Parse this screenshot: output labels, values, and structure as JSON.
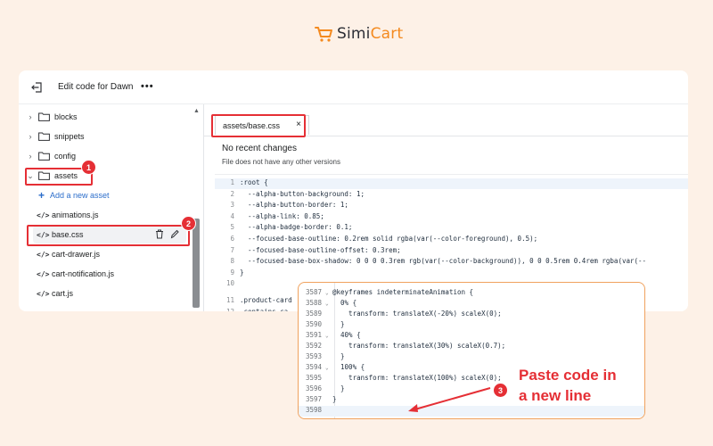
{
  "logo": {
    "text_main": "Simi",
    "text_accent": "Cart",
    "brand_color": "#f48a1f"
  },
  "topbar": {
    "title": "Edit code for Dawn",
    "more_label": "•••"
  },
  "sidebar": {
    "items": [
      {
        "type": "folder",
        "label": "blocks"
      },
      {
        "type": "folder",
        "label": "snippets"
      },
      {
        "type": "folder",
        "label": "config"
      },
      {
        "type": "folder-open",
        "label": "assets"
      },
      {
        "type": "add",
        "label": "Add a new asset"
      },
      {
        "type": "file",
        "label": "animations.js"
      },
      {
        "type": "file",
        "label": "base.css"
      },
      {
        "type": "file",
        "label": "cart-drawer.js"
      },
      {
        "type": "file",
        "label": "cart-notification.js"
      },
      {
        "type": "file",
        "label": "cart.js"
      }
    ]
  },
  "editor": {
    "tab_prefix": "assets/",
    "tab_file": "base.css",
    "tab_close": "×",
    "no_changes_title": "No recent changes",
    "no_changes_sub": "File does not have any other versions",
    "code": [
      {
        "n": "1",
        "t": ":root {"
      },
      {
        "n": "2",
        "t": "  --alpha-button-background: 1;"
      },
      {
        "n": "3",
        "t": "  --alpha-button-border: 1;"
      },
      {
        "n": "4",
        "t": "  --alpha-link: 0.85;"
      },
      {
        "n": "5",
        "t": "  --alpha-badge-border: 0.1;"
      },
      {
        "n": "6",
        "t": "  --focused-base-outline: 0.2rem solid rgba(var(--color-foreground), 0.5);"
      },
      {
        "n": "7",
        "t": "  --focused-base-outline-offset: 0.3rem;"
      },
      {
        "n": "8",
        "t": "  --focused-base-box-shadow: 0 0 0 0.3rem rgb(var(--color-background)), 0 0 0.5rem 0.4rem rgba(var(--"
      },
      {
        "n": "9",
        "t": "}"
      },
      {
        "n": "10",
        "t": ""
      },
      {
        "n": "11",
        "t": ".product-card"
      },
      {
        "n": "12",
        "t": ".contains-ca"
      }
    ]
  },
  "popup": {
    "code": [
      {
        "n": "3587",
        "t": "@keyframes indeterminateAnimation {"
      },
      {
        "n": "3588",
        "t": "  0% {"
      },
      {
        "n": "3589",
        "t": "    transform: translateX(-20%) scaleX(0);"
      },
      {
        "n": "3590",
        "t": "  }"
      },
      {
        "n": "3591",
        "t": "  40% {"
      },
      {
        "n": "3592",
        "t": "    transform: translateX(30%) scaleX(0.7);"
      },
      {
        "n": "3593",
        "t": "  }"
      },
      {
        "n": "3594",
        "t": "  100% {"
      },
      {
        "n": "3595",
        "t": "    transform: translateX(100%) scaleX(0);"
      },
      {
        "n": "3596",
        "t": "  }"
      },
      {
        "n": "3597",
        "t": "}"
      },
      {
        "n": "3598",
        "t": ""
      }
    ]
  },
  "annotations": {
    "badge1": "1",
    "badge2": "2",
    "badge3": "3",
    "paste_line1": "Paste code in",
    "paste_line2": "a new line",
    "accent_red": "#e52f35"
  }
}
